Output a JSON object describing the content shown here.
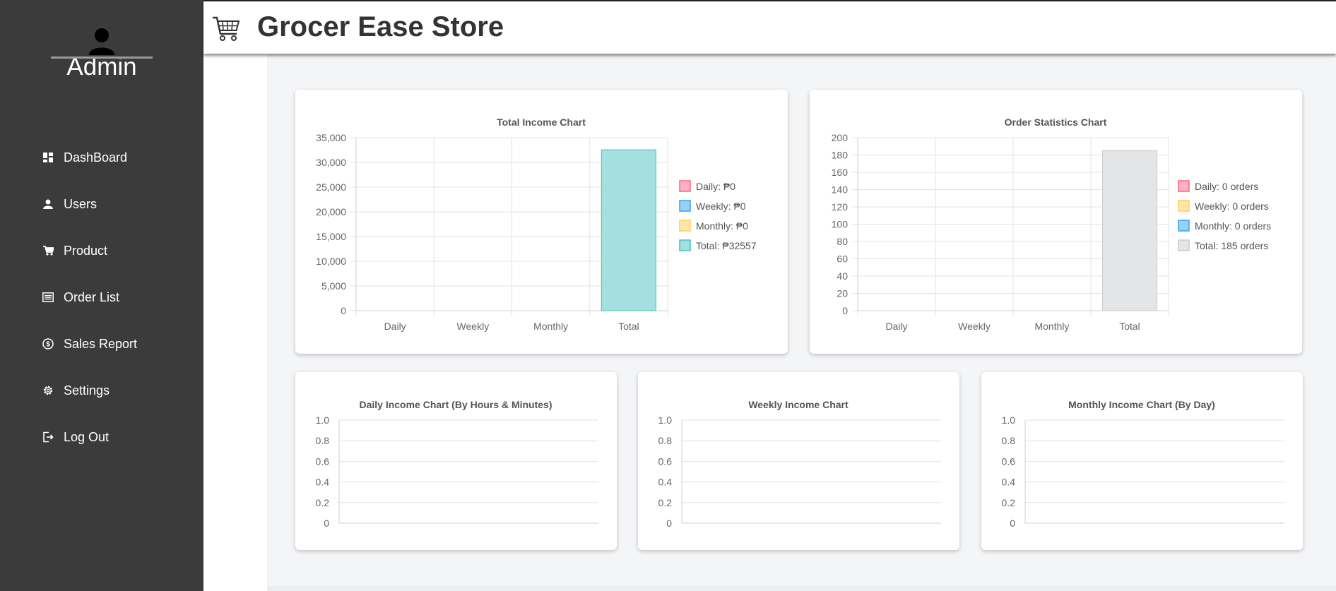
{
  "app": {
    "title": "Grocer Ease Store"
  },
  "sidebar": {
    "user": "Admin",
    "items": [
      {
        "label": "DashBoard",
        "icon": "dashboard-icon"
      },
      {
        "label": "Users",
        "icon": "user-icon"
      },
      {
        "label": "Product",
        "icon": "cart-icon"
      },
      {
        "label": "Order List",
        "icon": "list-icon"
      },
      {
        "label": "Sales Report",
        "icon": "dollar-icon"
      },
      {
        "label": "Settings",
        "icon": "gear-icon"
      },
      {
        "label": "Log Out",
        "icon": "logout-icon"
      }
    ]
  },
  "colors": {
    "sidebar": "#3b3b3b",
    "daily": "#ffb1c1",
    "weekly": "#9ad0f5",
    "monthly": "#ffe6aa",
    "total_income": "#a5dfdf",
    "total_orders": "#e4e5e7"
  },
  "chart_data": [
    {
      "id": "total-income",
      "type": "bar",
      "title": "Total Income Chart",
      "categories": [
        "Daily",
        "Weekly",
        "Monthly",
        "Total"
      ],
      "values": [
        0,
        0,
        0,
        32557
      ],
      "ylim": [
        0,
        35000
      ],
      "yticks": [
        "35,000",
        "30,000",
        "25,000",
        "20,000",
        "15,000",
        "10,000",
        "5,000",
        "0"
      ],
      "legend_position": "right",
      "legend": [
        {
          "label": "Daily: ₱0",
          "color": "#ffb1c1",
          "border": "#ff6384"
        },
        {
          "label": "Weekly: ₱0",
          "color": "#9ad0f5",
          "border": "#36a2eb"
        },
        {
          "label": "Monthly: ₱0",
          "color": "#ffe6aa",
          "border": "#ffcd56"
        },
        {
          "label": "Total: ₱32557",
          "color": "#a5dfdf",
          "border": "#4bc0c0"
        }
      ]
    },
    {
      "id": "order-statistics",
      "type": "bar",
      "title": "Order Statistics Chart",
      "categories": [
        "Daily",
        "Weekly",
        "Monthly",
        "Total"
      ],
      "values": [
        0,
        0,
        0,
        185
      ],
      "ylim": [
        0,
        200
      ],
      "yticks": [
        "200",
        "180",
        "160",
        "140",
        "120",
        "100",
        "80",
        "60",
        "40",
        "20",
        "0"
      ],
      "legend_position": "right",
      "legend": [
        {
          "label": "Daily: 0 orders",
          "color": "#ffb1c1",
          "border": "#ff6384"
        },
        {
          "label": "Weekly: 0 orders",
          "color": "#ffe6aa",
          "border": "#ffcd56"
        },
        {
          "label": "Monthly: 0 orders",
          "color": "#9ad0f5",
          "border": "#36a2eb"
        },
        {
          "label": "Total: 185 orders",
          "color": "#e4e5e7",
          "border": "#c9cbcf"
        }
      ]
    },
    {
      "id": "daily-income",
      "type": "line",
      "title": "Daily Income Chart (By Hours & Minutes)",
      "series": [],
      "ylim": [
        0,
        1
      ],
      "yticks": [
        "1.0",
        "0.8",
        "0.6",
        "0.4",
        "0.2",
        "0"
      ]
    },
    {
      "id": "weekly-income",
      "type": "line",
      "title": "Weekly Income Chart",
      "series": [],
      "ylim": [
        0,
        1
      ],
      "yticks": [
        "1.0",
        "0.8",
        "0.6",
        "0.4",
        "0.2",
        "0"
      ]
    },
    {
      "id": "monthly-income",
      "type": "line",
      "title": "Monthly Income Chart (By Day)",
      "series": [],
      "ylim": [
        0,
        1
      ],
      "yticks": [
        "1.0",
        "0.8",
        "0.6",
        "0.4",
        "0.2",
        "0"
      ]
    }
  ]
}
